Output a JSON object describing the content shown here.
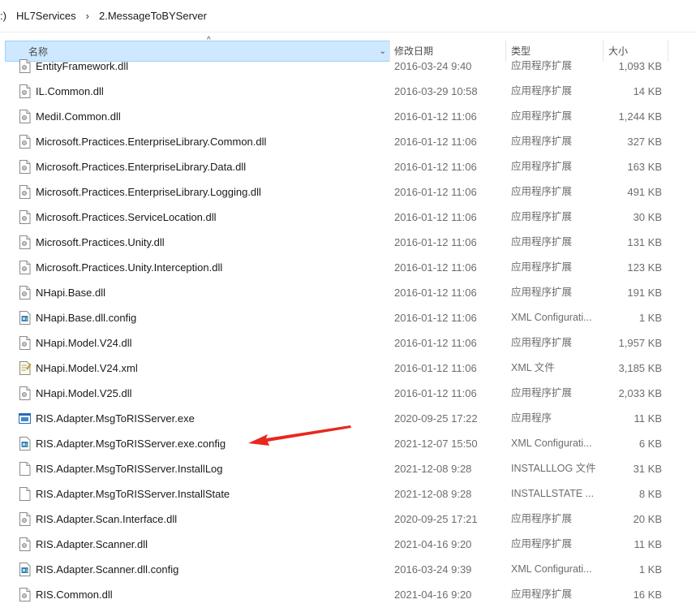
{
  "breadcrumb": {
    "root_fragment": ":)",
    "items": [
      "HL7Services",
      "2.MessageToBYServer"
    ]
  },
  "columns": {
    "name": "名称",
    "date": "修改日期",
    "type": "类型",
    "size": "大小"
  },
  "files": [
    {
      "name": "EntityFramework.dll",
      "date": "2016-03-24 9:40",
      "type": "应用程序扩展",
      "size": "1,093 KB",
      "icon": "dll-file-icon"
    },
    {
      "name": "IL.Common.dll",
      "date": "2016-03-29 10:58",
      "type": "应用程序扩展",
      "size": "14 KB",
      "icon": "dll-file-icon"
    },
    {
      "name": "MediI.Common.dll",
      "date": "2016-01-12 11:06",
      "type": "应用程序扩展",
      "size": "1,244 KB",
      "icon": "dll-file-icon"
    },
    {
      "name": "Microsoft.Practices.EnterpriseLibrary.Common.dll",
      "date": "2016-01-12 11:06",
      "type": "应用程序扩展",
      "size": "327 KB",
      "icon": "dll-file-icon"
    },
    {
      "name": "Microsoft.Practices.EnterpriseLibrary.Data.dll",
      "date": "2016-01-12 11:06",
      "type": "应用程序扩展",
      "size": "163 KB",
      "icon": "dll-file-icon"
    },
    {
      "name": "Microsoft.Practices.EnterpriseLibrary.Logging.dll",
      "date": "2016-01-12 11:06",
      "type": "应用程序扩展",
      "size": "491 KB",
      "icon": "dll-file-icon"
    },
    {
      "name": "Microsoft.Practices.ServiceLocation.dll",
      "date": "2016-01-12 11:06",
      "type": "应用程序扩展",
      "size": "30 KB",
      "icon": "dll-file-icon"
    },
    {
      "name": "Microsoft.Practices.Unity.dll",
      "date": "2016-01-12 11:06",
      "type": "应用程序扩展",
      "size": "131 KB",
      "icon": "dll-file-icon"
    },
    {
      "name": "Microsoft.Practices.Unity.Interception.dll",
      "date": "2016-01-12 11:06",
      "type": "应用程序扩展",
      "size": "123 KB",
      "icon": "dll-file-icon"
    },
    {
      "name": "NHapi.Base.dll",
      "date": "2016-01-12 11:06",
      "type": "应用程序扩展",
      "size": "191 KB",
      "icon": "dll-file-icon"
    },
    {
      "name": "NHapi.Base.dll.config",
      "date": "2016-01-12 11:06",
      "type": "XML Configurati...",
      "size": "1 KB",
      "icon": "config-file-icon"
    },
    {
      "name": "NHapi.Model.V24.dll",
      "date": "2016-01-12 11:06",
      "type": "应用程序扩展",
      "size": "1,957 KB",
      "icon": "dll-file-icon"
    },
    {
      "name": "NHapi.Model.V24.xml",
      "date": "2016-01-12 11:06",
      "type": "XML 文件",
      "size": "3,185 KB",
      "icon": "xml-file-icon"
    },
    {
      "name": "NHapi.Model.V25.dll",
      "date": "2016-01-12 11:06",
      "type": "应用程序扩展",
      "size": "2,033 KB",
      "icon": "dll-file-icon"
    },
    {
      "name": "RIS.Adapter.MsgToRISServer.exe",
      "date": "2020-09-25 17:22",
      "type": "应用程序",
      "size": "11 KB",
      "icon": "exe-file-icon"
    },
    {
      "name": "RIS.Adapter.MsgToRISServer.exe.config",
      "date": "2021-12-07 15:50",
      "type": "XML Configurati...",
      "size": "6 KB",
      "icon": "config-file-icon"
    },
    {
      "name": "RIS.Adapter.MsgToRISServer.InstallLog",
      "date": "2021-12-08 9:28",
      "type": "INSTALLLOG 文件",
      "size": "31 KB",
      "icon": "blank-file-icon"
    },
    {
      "name": "RIS.Adapter.MsgToRISServer.InstallState",
      "date": "2021-12-08 9:28",
      "type": "INSTALLSTATE ...",
      "size": "8 KB",
      "icon": "blank-file-icon"
    },
    {
      "name": "RIS.Adapter.Scan.Interface.dll",
      "date": "2020-09-25 17:21",
      "type": "应用程序扩展",
      "size": "20 KB",
      "icon": "dll-file-icon"
    },
    {
      "name": "RIS.Adapter.Scanner.dll",
      "date": "2021-04-16 9:20",
      "type": "应用程序扩展",
      "size": "11 KB",
      "icon": "dll-file-icon"
    },
    {
      "name": "RIS.Adapter.Scanner.dll.config",
      "date": "2016-03-24 9:39",
      "type": "XML Configurati...",
      "size": "1 KB",
      "icon": "config-file-icon"
    },
    {
      "name": "RIS.Common.dll",
      "date": "2021-04-16 9:20",
      "type": "应用程序扩展",
      "size": "16 KB",
      "icon": "dll-file-icon"
    }
  ],
  "annotation": {
    "color": "#e8281e",
    "target_file": "RIS.Adapter.MsgToRISServer.exe.config"
  },
  "colors": {
    "header_selected_bg": "#cde8ff",
    "header_selected_border": "#99d1ff",
    "secondary_text": "#6d6d6d"
  }
}
